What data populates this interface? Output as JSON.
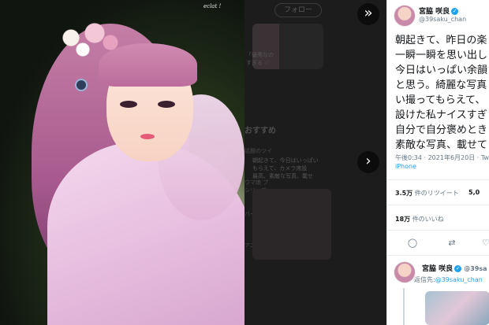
{
  "photo": {
    "watermark": "eclat !"
  },
  "middle": {
    "follow_label": "フォロー",
    "ghost_lines_top": [
      "「優秀なの",
      "すぎる ☆"
    ],
    "recommend_header": "おすすめ",
    "ghost_tweet": [
      "朝起きて、今日はいっぱい",
      "もらえて、カメラ席設",
      "最高、素敵な写真、載せ"
    ],
    "sections": [
      "話題のツイ",
      "ウマ娘 プ",
      "シリーズ",
      "バーチャル",
      "アニメ・ア"
    ]
  },
  "nav": {
    "prev_icon": "‹",
    "next_icon": "›",
    "close_icon": "»"
  },
  "tweet": {
    "author_name": "宮脇 咲良",
    "author_handle": "@39saku_chan",
    "text_lines": [
      "朝起きて、昨日の楽",
      "一瞬一瞬を思い出し",
      "今日はいっぱい余韻",
      "と思う。綺麗な写真",
      "い撮ってもらえて、",
      "設けた私ナイスすぎ",
      "自分で自分褒めとき",
      "素敵な写真、載せて"
    ],
    "meta": "午後0:34 · 2021年6月20日 · Tw",
    "client": "iPhone",
    "retweets_count": "3.5万",
    "retweets_label": "件のリツイート",
    "quotes_count": "5,0",
    "likes_count": "18万",
    "likes_label": "件のいいね",
    "reply": {
      "author_name": "宮脇 咲良",
      "author_handle": "@39sa",
      "reply_prefix": "返信先:",
      "reply_handle": "@39saku_chan"
    }
  }
}
